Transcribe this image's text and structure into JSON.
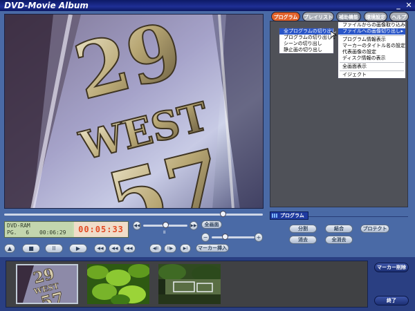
{
  "window": {
    "title": "DVD-Movie Album",
    "minimize_label": "_",
    "close_label": "✕"
  },
  "tabs": [
    {
      "label": "プログラム"
    },
    {
      "label": "プレイリスト"
    },
    {
      "label": "補助機能"
    },
    {
      "label": "環境設定"
    },
    {
      "label": "ヘルプ"
    }
  ],
  "program_menu": {
    "items": [
      "全プログラムの切り出し",
      "プログラムの切り出し",
      "シーンの切り出し",
      "静止画の切り出し"
    ],
    "selected": 0
  },
  "aux_menu": {
    "items": [
      "ファイルからの画像取り込み",
      "ファイルへの画像切り出し",
      "プログラム情報表示",
      "マーカーのタイトル名の設定",
      "代表画像の設定",
      "ディスク情報の表示",
      "全画面表示",
      "イジェクト"
    ],
    "selected": 1,
    "submenu_arrow": "▸"
  },
  "video": {
    "sign_line1": "29",
    "sign_line2": "WEST",
    "sign_line3": "57"
  },
  "lcd": {
    "disc": "DVD-RAM",
    "pg_label": "PG.",
    "pg_number": "6",
    "total_time": "00:06:29",
    "current_time": "00:05:33"
  },
  "controls": {
    "fullscreen_label": "全画面",
    "marker_insert_label": "マーカー挿入",
    "skip_back_icon": "◀◀",
    "skip_fwd_icon": "▶▶",
    "pause_mark": "II",
    "vol_minus": "−",
    "vol_plus": "+",
    "transport": [
      "▲",
      "■",
      "II",
      "▶",
      "◀◀",
      "◀◀",
      "◀◀",
      "◀II",
      "II▶",
      "▶I"
    ]
  },
  "program_panel": {
    "title": "プログラム",
    "buttons": [
      "分割",
      "結合",
      "プロテクト",
      "消去",
      "全消去"
    ]
  },
  "side_buttons": {
    "marker_delete": "マーカー削除",
    "exit": "終了"
  },
  "thumbnails": {
    "first_sign_text": "WEST",
    "first_sign_num1": "29",
    "first_sign_num2": "57"
  },
  "colors": {
    "accent_orange": "#e2622a",
    "lcd_red": "#e24a24",
    "panel_blue": "#4a6aa6"
  }
}
